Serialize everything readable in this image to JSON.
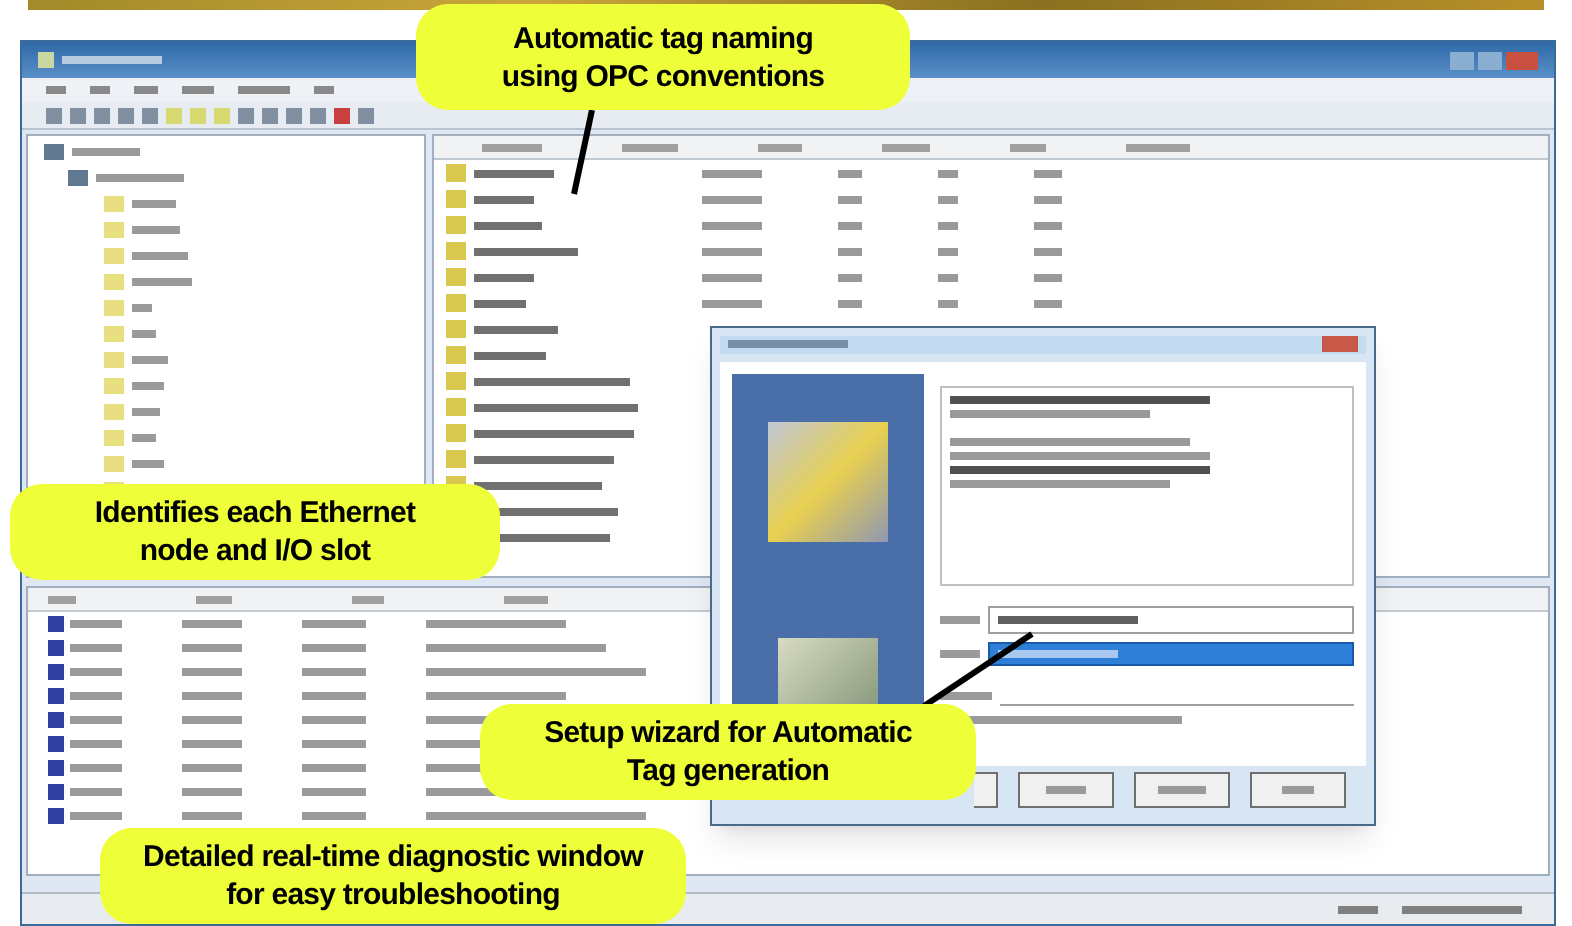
{
  "callouts": [
    {
      "text": "Automatic tag naming using OPC conventions"
    },
    {
      "text": "Identifies each Ethernet node and I/O slot"
    },
    {
      "text": "Setup wizard for Automatic Tag generation"
    },
    {
      "text": "Detailed real-time diagnostic window for easy troubleshooting"
    }
  ]
}
